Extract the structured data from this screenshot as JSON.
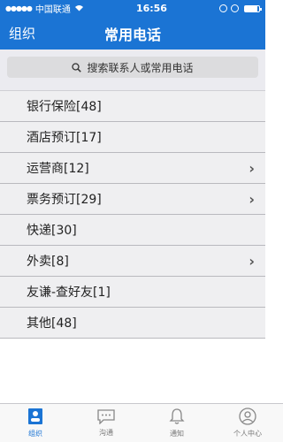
{
  "status_bar": {
    "carrier": "中国联通",
    "time": "16:56",
    "battery_level": 0.9
  },
  "header": {
    "left_label": "组织",
    "title": "常用电话"
  },
  "search": {
    "placeholder": "搜索联系人或常用电话"
  },
  "list": [
    {
      "label": "银行保险[48]",
      "has_chevron": false
    },
    {
      "label": "酒店预订[17]",
      "has_chevron": false
    },
    {
      "label": "运营商[12]",
      "has_chevron": true
    },
    {
      "label": "票务预订[29]",
      "has_chevron": true
    },
    {
      "label": "快递[30]",
      "has_chevron": false
    },
    {
      "label": "外卖[8]",
      "has_chevron": true
    },
    {
      "label": "友谦-查好友[1]",
      "has_chevron": false
    },
    {
      "label": "其他[48]",
      "has_chevron": false
    }
  ],
  "tabbar": [
    {
      "label": "组织",
      "icon": "org-icon",
      "active": true
    },
    {
      "label": "沟通",
      "icon": "chat-icon",
      "active": false
    },
    {
      "label": "通知",
      "icon": "bell-icon",
      "active": false
    },
    {
      "label": "个人中心",
      "icon": "user-icon",
      "active": false
    }
  ],
  "colors": {
    "brand": "#1b74d4",
    "list_bg": "#efeff1",
    "separator": "#b9b9be"
  }
}
